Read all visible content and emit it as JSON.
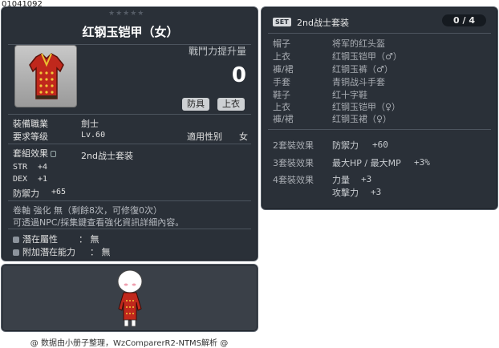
{
  "item_id": "01041092",
  "tooltip": {
    "stars": "★★★★★",
    "title": "红钢玉铠甲（女）",
    "power_label": "戰鬥力提升量",
    "power_value": "0",
    "tags": [
      "防具",
      "上衣"
    ],
    "job_label": "裝備職業",
    "job_value": "劍士",
    "level_label": "要求等级",
    "level_value": "Lv.60",
    "gender_label": "適用性别",
    "gender_value": "女",
    "set_label": "套組效果",
    "set_value": "2nd战士套装",
    "stats": [
      {
        "name": "STR",
        "value": "+4"
      },
      {
        "name": "DEX",
        "value": "+1"
      },
      {
        "name": "防禦力",
        "value": "+65"
      }
    ],
    "upgrade_text": "卷軸 強化 無（剩餘8次，可修復0次）",
    "hint_text": "可透過NPC/採集鍵查看強化資訊詳細內容。",
    "potential_label": "潛在屬性",
    "potential_value": "： 無",
    "additional_label": "附加潛在能力",
    "additional_value": "： 無"
  },
  "set_panel": {
    "badge": "SET",
    "name": "2nd战士套装",
    "count": "0 / 4",
    "items": [
      {
        "slot": "帽子",
        "name": "将军的红头盔"
      },
      {
        "slot": "上衣",
        "name": "红钢玉铠甲（♂）"
      },
      {
        "slot": "褲/裙",
        "name": "红钢玉裤（♂）"
      },
      {
        "slot": "手套",
        "name": "青铜战斗手套"
      },
      {
        "slot": "鞋子",
        "name": "红十字鞋"
      },
      {
        "slot": "上衣",
        "name": "红钢玉铠甲（♀）"
      },
      {
        "slot": "褲/裙",
        "name": "红钢玉裙（♀）"
      }
    ],
    "effects": [
      {
        "label": "2套裝效果",
        "lines": [
          {
            "text": "防禦力",
            "val": "+60"
          }
        ]
      },
      {
        "label": "3套裝效果",
        "lines": [
          {
            "text": "最大HP / 最大MP",
            "val": "+3%"
          }
        ]
      },
      {
        "label": "4套裝效果",
        "lines": [
          {
            "text": "力量",
            "val": "+3"
          },
          {
            "text": "攻擊力",
            "val": "+3"
          }
        ]
      }
    ]
  },
  "footer": "@ 数据由小册子整理，WzComparerR2-NTMS解析 @"
}
